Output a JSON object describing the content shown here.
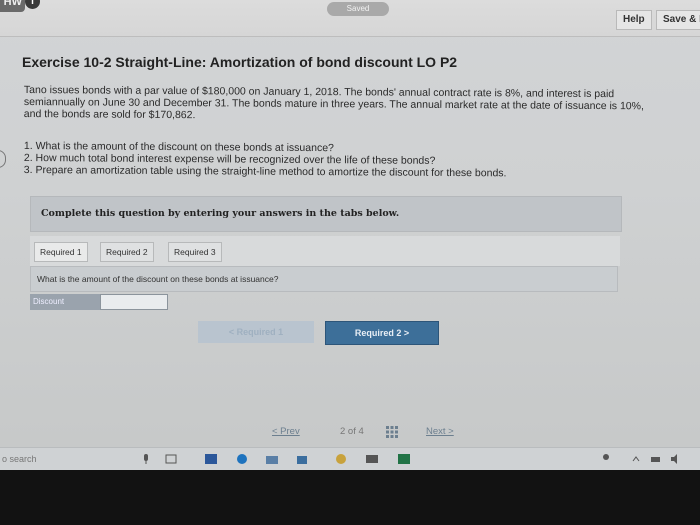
{
  "topbar": {
    "hw_label": "HW",
    "saved_label": "Saved",
    "help_label": "Help",
    "save_exit_label": "Save & E"
  },
  "exercise": {
    "title": "Exercise 10-2 Straight-Line: Amortization of bond discount LO P2",
    "paragraph": "Tano issues bonds with a par value of $180,000 on January 1, 2018. The bonds' annual contract rate is 8%, and interest is paid semiannually on June 30 and December 31. The bonds mature in three years. The annual market rate at the date of issuance is 10%, and the bonds are sold for $170,862.",
    "questions": [
      "1. What is the amount of the discount on these bonds at issuance?",
      "2. How much total bond interest expense will be recognized over the life of these bonds?",
      "3. Prepare an amortization table using the straight-line method to amortize the discount for these bonds."
    ]
  },
  "instructions": "Complete this question by entering your answers in the tabs below.",
  "tabs": [
    {
      "label": "Required 1"
    },
    {
      "label": "Required 2"
    },
    {
      "label": "Required 3"
    }
  ],
  "panel": {
    "question": "What is the amount of the discount on these bonds at issuance?",
    "discount_label": "Discount",
    "discount_value": ""
  },
  "nav_buttons": {
    "prev": "< Required 1",
    "next": "Required 2 >"
  },
  "pager": {
    "prev": "< Prev",
    "indicator": "2 of 4",
    "next": "Next >"
  },
  "taskbar": {
    "search_placeholder": "o search"
  },
  "colors": {
    "next_button": "#3d6f99",
    "discount_label_bg": "#9aa3ad"
  }
}
